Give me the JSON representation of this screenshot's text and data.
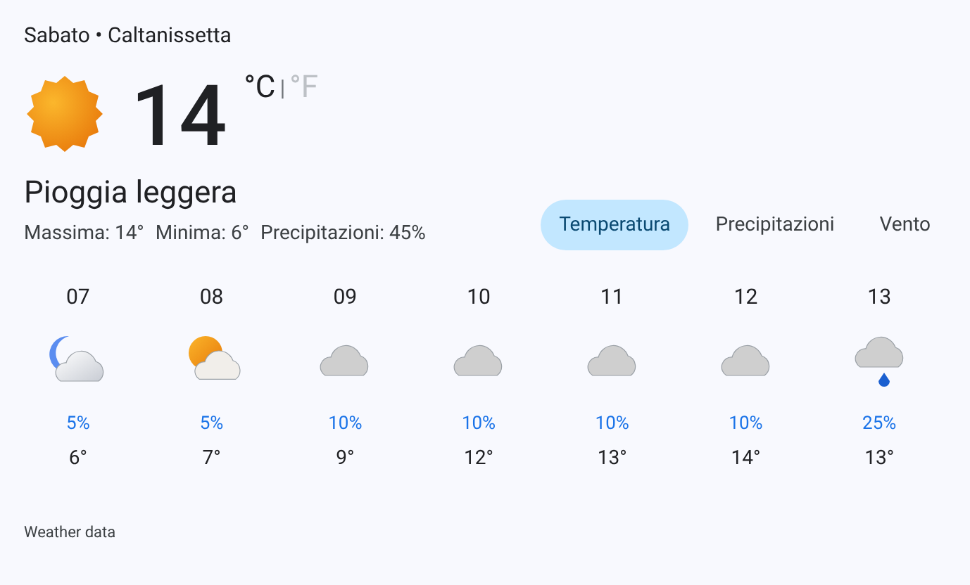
{
  "header": "Sabato • Caltanissetta",
  "current": {
    "temperature": "14",
    "units": [
      {
        "label": "°C",
        "selected": true
      },
      {
        "label": "°F",
        "selected": false
      }
    ],
    "separator": "|"
  },
  "condition": "Pioggia leggera",
  "details": [
    "Massima: 14°",
    "Minima: 6°",
    "Precipitazioni: 45%"
  ],
  "tabs": [
    {
      "label": "Temperatura",
      "selected": true
    },
    {
      "label": "Precipitazioni",
      "selected": false
    },
    {
      "label": "Vento",
      "selected": false
    }
  ],
  "hours": [
    {
      "time": "07",
      "kind": "moon-cloud",
      "precip": "5%",
      "temp": "6°"
    },
    {
      "time": "08",
      "kind": "sun-cloud",
      "precip": "5%",
      "temp": "7°"
    },
    {
      "time": "09",
      "kind": "cloud",
      "precip": "10%",
      "temp": "9°"
    },
    {
      "time": "10",
      "kind": "cloud",
      "precip": "10%",
      "temp": "12°"
    },
    {
      "time": "11",
      "kind": "cloud",
      "precip": "10%",
      "temp": "13°"
    },
    {
      "time": "12",
      "kind": "cloud",
      "precip": "10%",
      "temp": "14°"
    },
    {
      "time": "13",
      "kind": "rain",
      "precip": "25%",
      "temp": "13°"
    }
  ],
  "footer": "Weather data"
}
